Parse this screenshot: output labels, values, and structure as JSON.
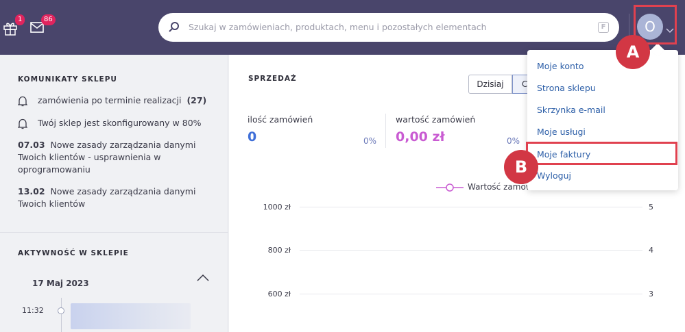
{
  "topbar": {
    "gift_badge": "1",
    "mail_badge": "86",
    "search_placeholder": "Szukaj w zamówieniach, produktach, menu i pozostałych elementach",
    "search_shortcut": "F",
    "avatar_letter": "O"
  },
  "markers": {
    "a": "A",
    "b": "B"
  },
  "store_messages": {
    "heading": "KOMUNIKATY SKLEPU",
    "alerts": [
      {
        "text": "zamówienia po terminie realizacji",
        "count": "(27)"
      },
      {
        "text": "Twój sklep jest skonfigurowany w 80%"
      }
    ],
    "news": [
      {
        "date": "07.03",
        "text": "Nowe zasady zarządzania danymi Twoich klientów - usprawnienia w oprogramowaniu"
      },
      {
        "date": "13.02",
        "text": "Nowe zasady zarządzania danymi Twoich klientów"
      }
    ]
  },
  "activity": {
    "heading": "AKTYWNOŚĆ W SKLEPIE",
    "date": "17 Maj 2023",
    "time": "11:32"
  },
  "sales": {
    "heading": "SPRZEDAŻ",
    "btn_today": "Dzisiaj",
    "btn_next": "C",
    "orders_label": "ilość zamówień",
    "orders_value": "0",
    "orders_pct": "0%",
    "value_label": "wartość zamówień",
    "value_value": "0,00 zł",
    "value_pct": "0%",
    "legend": "Wartość zamów",
    "y_left": [
      "1000 zł",
      "800 zł",
      "600 zł"
    ],
    "y_right": [
      "5",
      "4",
      "3"
    ]
  },
  "dropdown": {
    "items": [
      "Moje konto",
      "Strona sklepu",
      "Skrzynka e-mail",
      "Moje usługi",
      "Moje faktury",
      "Wyloguj"
    ]
  },
  "colors": {
    "topbar": "#49456b",
    "accent_blue": "#3f6fd8",
    "accent_pink": "#c95bd2",
    "highlight": "#e0414f"
  }
}
